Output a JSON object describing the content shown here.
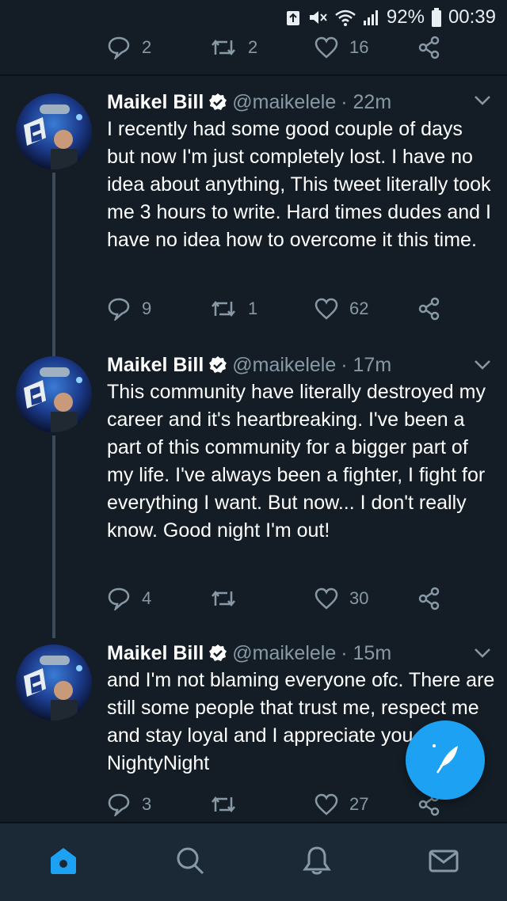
{
  "status_bar": {
    "battery_percent": "92%",
    "time": "00:39",
    "icons": [
      "recycle-icon",
      "mute-icon",
      "wifi-icon",
      "signal-icon",
      "battery-icon"
    ]
  },
  "top_tweet_actions": {
    "replies": "2",
    "retweets": "2",
    "likes": "16"
  },
  "tweets": [
    {
      "name": "Maikel Bill",
      "handle": "@maikelele",
      "time": "· 22m",
      "text": "I recently had some good couple of days but now I'm just completely lost. I have no idea about anything, This tweet literally took me 3 hours to write. Hard times dudes and I have no idea how to overcome it this time.",
      "replies": "9",
      "retweets": "1",
      "likes": "62"
    },
    {
      "name": "Maikel Bill",
      "handle": "@maikelele",
      "time": "· 17m",
      "text": "This community have literally destroyed my career and it's heartbreaking. I've been a part of this community for a bigger part of my life. I've always been a fighter, I fight for everything I want. But now... I don't really know. Good night I'm out!",
      "replies": "4",
      "retweets": "",
      "likes": "30"
    },
    {
      "name": "Maikel Bill",
      "handle": "@maikelele",
      "time": "· 15m",
      "text": "and I'm not blaming everyone ofc. There are still some people that trust me, respect me and stay loyal and I appreciate you. NightyNight",
      "replies": "3",
      "retweets": "",
      "likes": "27"
    }
  ],
  "bottom_nav": [
    "home-icon",
    "search-icon",
    "notifications-icon",
    "messages-icon"
  ],
  "colors": {
    "background": "#141d26",
    "accent": "#1da1f2",
    "muted": "#8899a6",
    "nav_background": "#1b2836"
  }
}
